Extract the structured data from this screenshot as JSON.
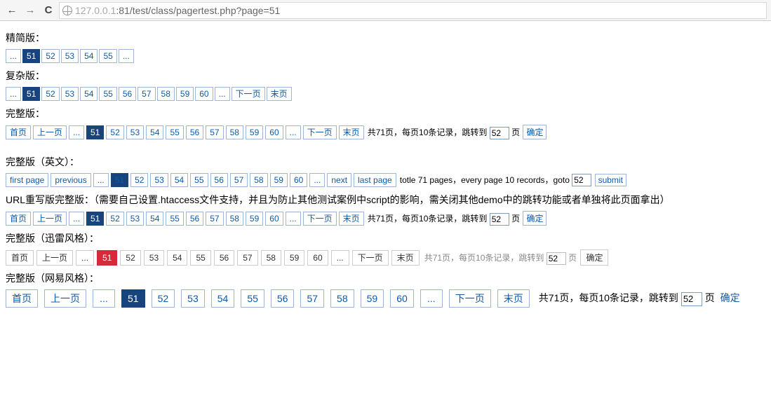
{
  "chrome": {
    "url_host_dim": "127.0.0.1",
    "url_port_path": ":81/test/class/pagertest.php?page=51"
  },
  "sections": {
    "simple_title": "精简版：",
    "complex_title": "复杂版：",
    "full_title": "完整版：",
    "full_en_title": "完整版（英文）：",
    "rewrite_title": "URL重写版完整版：（需要自己设置.htaccess文件支持，并且为防止其他测试案例中script的影响，需关闭其他demo中的跳转功能或者单独将此页面拿出）",
    "xunlei_title": "完整版（迅雷风格）：",
    "netease_title": "完整版（网易风格）："
  },
  "common": {
    "ellipsis": "...",
    "first_cn": "首页",
    "prev_cn": "上一页",
    "next_cn": "下一页",
    "last_cn": "末页",
    "first_en": "first page",
    "prev_en": "previous",
    "next_en": "next",
    "last_en": "last page",
    "submit_cn": "确定",
    "submit_en": "submit"
  },
  "pager_simple": {
    "pages": [
      "51",
      "52",
      "53",
      "54",
      "55"
    ]
  },
  "pager_complex": {
    "pages": [
      "51",
      "52",
      "53",
      "54",
      "55",
      "56",
      "57",
      "58",
      "59",
      "60"
    ]
  },
  "pager_full": {
    "pages": [
      "51",
      "52",
      "53",
      "54",
      "55",
      "56",
      "57",
      "58",
      "59",
      "60"
    ],
    "info_pre": "共71页，每页10条记录，跳转到",
    "goto": "52",
    "info_post": "页"
  },
  "pager_full_en": {
    "pages": [
      "51",
      "52",
      "53",
      "54",
      "55",
      "56",
      "57",
      "58",
      "59",
      "60"
    ],
    "info_pre": "totle 71 pages，every page 10 records，goto",
    "goto": "52"
  },
  "pager_rewrite": {
    "pages": [
      "51",
      "52",
      "53",
      "54",
      "55",
      "56",
      "57",
      "58",
      "59",
      "60"
    ],
    "info_pre": "共71页，每页10条记录，跳转到",
    "goto": "52",
    "info_post": "页"
  },
  "pager_xunlei": {
    "pages": [
      "51",
      "52",
      "53",
      "54",
      "55",
      "56",
      "57",
      "58",
      "59",
      "60"
    ],
    "info_pre": "共71页，每页10条记录，跳转到",
    "goto": "52",
    "info_post": "页"
  },
  "pager_netease": {
    "pages": [
      "51",
      "52",
      "53",
      "54",
      "55",
      "56",
      "57",
      "58",
      "59",
      "60"
    ],
    "info_pre": "共71页，每页10条记录，跳转到",
    "goto": "52",
    "info_post": "页"
  }
}
